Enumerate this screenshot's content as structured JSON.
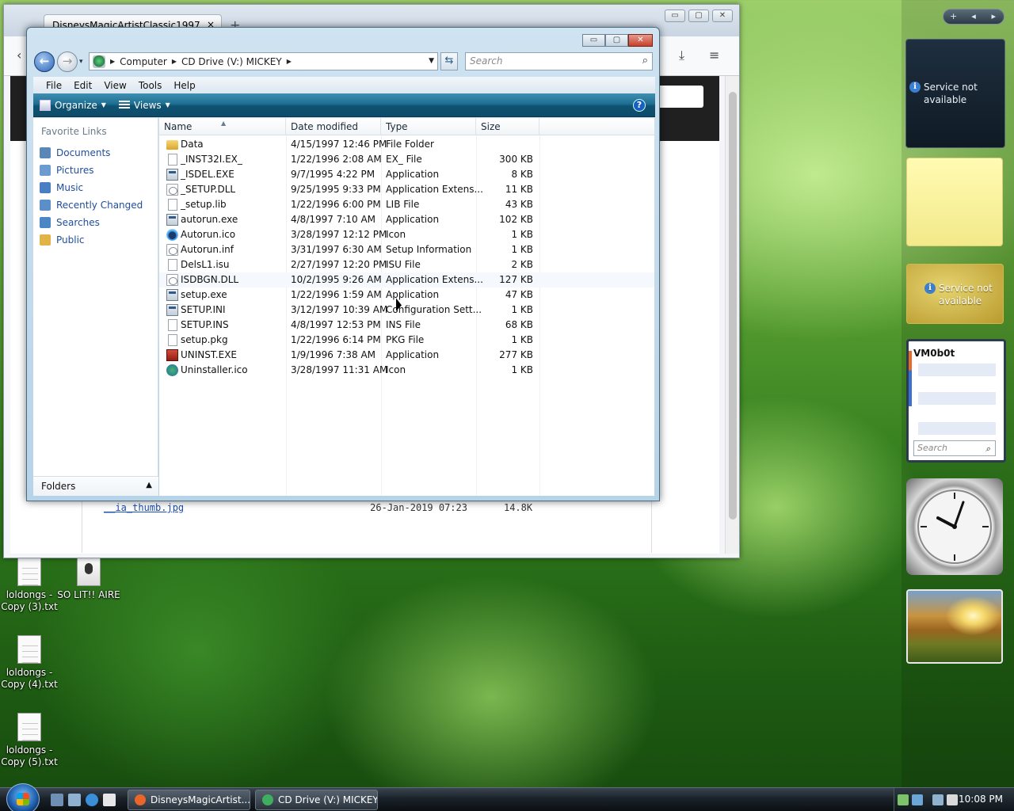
{
  "firefox": {
    "tab_title": "DisneysMagicArtistClassic1997",
    "tab_close": "×",
    "new_tab": "+",
    "controls": {
      "minimize": "▭",
      "maximize": "▢",
      "close": "✕"
    },
    "listing_row": {
      "filename": "__ia_thumb.jpg",
      "date": "26-Jan-2019 07:23",
      "size": "14.8K"
    }
  },
  "explorer": {
    "controls": {
      "minimize": "▭",
      "maximize": "▢",
      "close": "✕"
    },
    "breadcrumb": [
      "Computer",
      "CD Drive (V:) MICKEY"
    ],
    "search_placeholder": "Search",
    "menu": [
      "File",
      "Edit",
      "View",
      "Tools",
      "Help"
    ],
    "toolbar": {
      "organize": "Organize",
      "views": "Views",
      "help": "?"
    },
    "nav": {
      "favorites_title": "Favorite Links",
      "links": [
        {
          "label": "Documents",
          "icon": "documents-icon",
          "color": "#5b86b8"
        },
        {
          "label": "Pictures",
          "icon": "pictures-icon",
          "color": "#6b9bd0"
        },
        {
          "label": "Music",
          "icon": "music-icon",
          "color": "#4a7ec2"
        },
        {
          "label": "Recently Changed",
          "icon": "recent-icon",
          "color": "#5a8fc9"
        },
        {
          "label": "Searches",
          "icon": "searches-icon",
          "color": "#4b86c6"
        },
        {
          "label": "Public",
          "icon": "public-folder-icon",
          "color": "#e2b446"
        }
      ],
      "folders_label": "Folders"
    },
    "columns": [
      "Name",
      "Date modified",
      "Type",
      "Size"
    ],
    "files": [
      {
        "name": "Data",
        "date": "4/15/1997 12:46 PM",
        "type": "File Folder",
        "size": "",
        "icon": "folder"
      },
      {
        "name": "_INST32I.EX_",
        "date": "1/22/1996 2:08 AM",
        "type": "EX_ File",
        "size": "300 KB",
        "icon": "file"
      },
      {
        "name": "_ISDEL.EXE",
        "date": "9/7/1995 4:22 PM",
        "type": "Application",
        "size": "8 KB",
        "icon": "app"
      },
      {
        "name": "_SETUP.DLL",
        "date": "9/25/1995 9:33 PM",
        "type": "Application Extens...",
        "size": "11 KB",
        "icon": "dll"
      },
      {
        "name": "_setup.lib",
        "date": "1/22/1996 6:00 PM",
        "type": "LIB File",
        "size": "43 KB",
        "icon": "file"
      },
      {
        "name": "autorun.exe",
        "date": "4/8/1997 7:10 AM",
        "type": "Application",
        "size": "102 KB",
        "icon": "app"
      },
      {
        "name": "Autorun.ico",
        "date": "3/28/1997 12:12 PM",
        "type": "Icon",
        "size": "1 KB",
        "icon": "mickey"
      },
      {
        "name": "Autorun.inf",
        "date": "3/31/1997 6:30 AM",
        "type": "Setup Information",
        "size": "1 KB",
        "icon": "dll"
      },
      {
        "name": "DelsL1.isu",
        "date": "2/27/1997 12:20 PM",
        "type": "ISU File",
        "size": "2 KB",
        "icon": "file"
      },
      {
        "name": "ISDBGN.DLL",
        "date": "10/2/1995 9:26 AM",
        "type": "Application Extens...",
        "size": "127 KB",
        "icon": "dll"
      },
      {
        "name": "setup.exe",
        "date": "1/22/1996 1:59 AM",
        "type": "Application",
        "size": "47 KB",
        "icon": "app"
      },
      {
        "name": "SETUP.INI",
        "date": "3/12/1997 10:39 AM",
        "type": "Configuration Sett...",
        "size": "1 KB",
        "icon": "app"
      },
      {
        "name": "SETUP.INS",
        "date": "4/8/1997 12:53 PM",
        "type": "INS File",
        "size": "68 KB",
        "icon": "file"
      },
      {
        "name": "setup.pkg",
        "date": "1/22/1996 6:14 PM",
        "type": "PKG File",
        "size": "1 KB",
        "icon": "file"
      },
      {
        "name": "UNINST.EXE",
        "date": "1/9/1996 7:38 AM",
        "type": "Application",
        "size": "277 KB",
        "icon": "uninst"
      },
      {
        "name": "Uninstaller.ico",
        "date": "3/28/1997 11:31 AM",
        "type": "Icon",
        "size": "1 KB",
        "icon": "uninstico"
      }
    ]
  },
  "desktop_icons": [
    {
      "label": "loldongs - Copy (3).txt",
      "icon": "text-file-icon"
    },
    {
      "label": "SO LIT!! AIRE",
      "icon": "audio-file-icon"
    },
    {
      "label": "loldongs - Copy (4).txt",
      "icon": "text-file-icon"
    },
    {
      "label": "loldongs - Copy (5).txt",
      "icon": "text-file-icon"
    }
  ],
  "sidebar": {
    "controls": [
      "+",
      "◂",
      "▸"
    ],
    "feed_message": "Service not available",
    "weather_message": "Service not available",
    "contacts_title": "VM0b0t",
    "contacts_search": "Search"
  },
  "taskbar": {
    "buttons": [
      {
        "label": "DisneysMagicArtist...",
        "icon_color": "#e8662a"
      },
      {
        "label": "CD Drive (V:) MICKEY",
        "icon_color": "#3fae5f"
      }
    ],
    "time": "10:08 PM"
  }
}
